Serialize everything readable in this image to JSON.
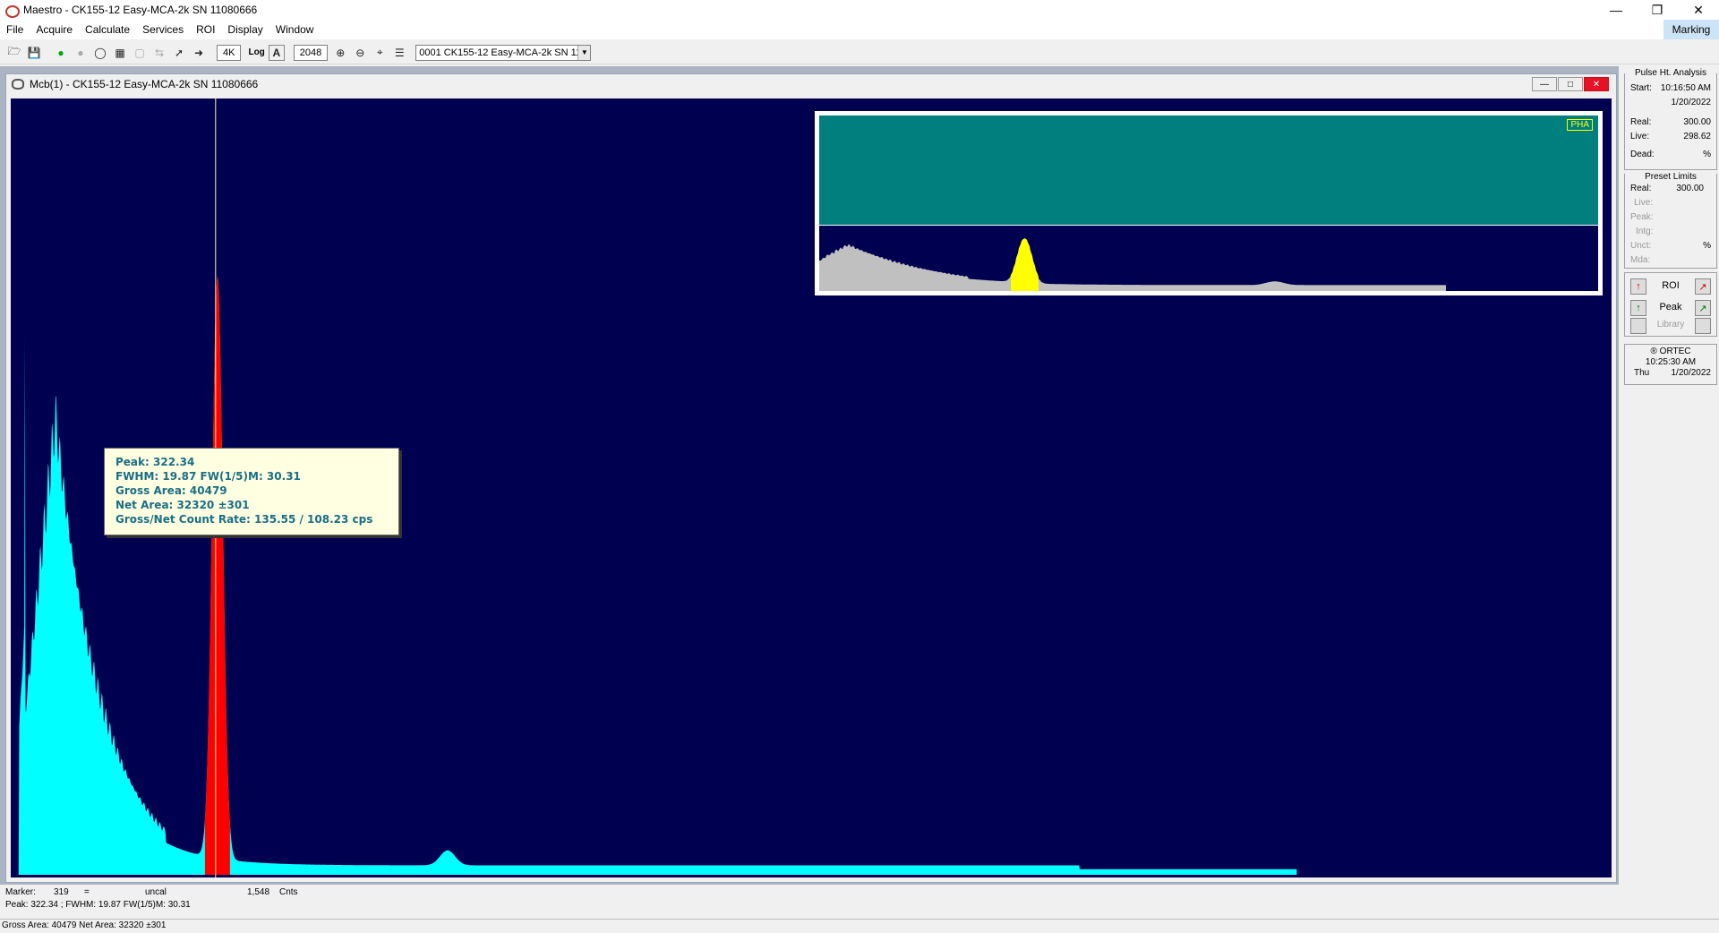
{
  "window": {
    "title": "Maestro - CK155-12 Easy-MCA-2k SN 11080666"
  },
  "menu": [
    "File",
    "Acquire",
    "Calculate",
    "Services",
    "ROI",
    "Display",
    "Window"
  ],
  "marking_label": "Marking",
  "toolbar": {
    "zoom_label": "4K",
    "log_label": "Log",
    "auto_label": "A",
    "vscale_value": "2048",
    "detector": "0001 CK155-12 Easy-MCA-2k SN 11"
  },
  "child": {
    "title": "Mcb(1) - CK155-12 Easy-MCA-2k SN 11080666"
  },
  "inset": {
    "mode_label": "PHA"
  },
  "tooltip": {
    "line1": "Peak: 322.34",
    "line2": "FWHM: 19.87  FW(1/5)M: 30.31",
    "line3": "Gross Area: 40479",
    "line4": "Net Area: 32320 ±301",
    "line5": "Gross/Net Count Rate: 135.55 / 108.23 cps"
  },
  "status": {
    "marker_label": "Marker:",
    "marker_value": "319",
    "eq": "=",
    "uncal": "uncal",
    "counts": "1,548",
    "counts_unit": "Cnts",
    "peak_line": "Peak: 322.34 ;  FWHM: 19.87  FW(1/5)M: 30.31",
    "area_line": "Gross Area: 40479  Net Area: 32320 ±301"
  },
  "pha": {
    "title": "Pulse Ht. Analysis",
    "start_label": "Start:",
    "start_time": "10:16:50 AM",
    "start_date": "1/20/2022",
    "real_label": "Real:",
    "real_value": "300.00",
    "live_label": "Live:",
    "live_value": "298.62",
    "dead_label": "Dead:",
    "dead_unit": "%"
  },
  "preset": {
    "title": "Preset Limits",
    "real_label": "Real:",
    "real_value": "300.00",
    "live_label": "Live:",
    "peak_label": "Peak:",
    "intg_label": "Intg:",
    "unct_label": "Unct:",
    "unct_unit": "%",
    "mda_label": "Mda:"
  },
  "nav": {
    "roi_label": "ROI",
    "peak_label": "Peak",
    "library_label": "Library"
  },
  "clock": {
    "brand": "® ORTEC",
    "time": "10:25:30 AM",
    "day": "Thu",
    "date": "1/20/2022"
  },
  "colors": {
    "spectrum_bg": "#000050",
    "spectrum": "#00ffff",
    "roi": "#ff0000",
    "marker": "#ffffa0",
    "inset_top": "#007f7f",
    "inset_spectrum": "#c0c0c0",
    "inset_roi": "#ffff00"
  },
  "spectrum_data": {
    "channels": 2048,
    "ymax": 2048,
    "roi_channels": [
      302,
      342
    ],
    "marker_channel": 319,
    "peaks": [
      {
        "channel": 322,
        "height": 1548
      },
      {
        "channel": 63,
        "height": 1220
      },
      {
        "channel": 690,
        "height": 40
      }
    ]
  }
}
